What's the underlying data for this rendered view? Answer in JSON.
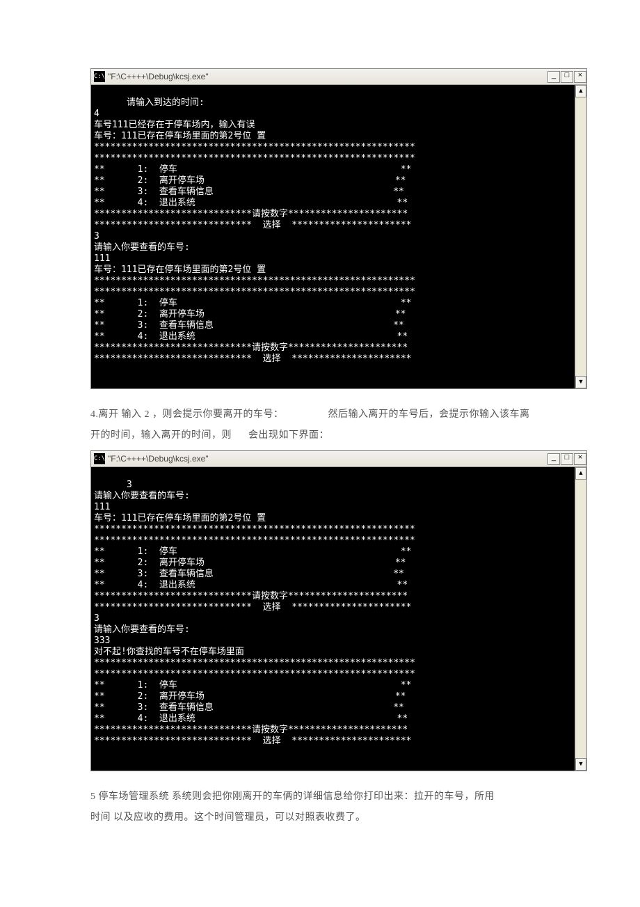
{
  "window_title": "\"F:\\C++++\\Debug\\kcsj.exe\"",
  "win_icon_text": "C:\\",
  "win_buttons": {
    "min": "_",
    "max": "□",
    "close": "×"
  },
  "scroll": {
    "up": "▲",
    "down": "▼"
  },
  "console1_lines": [
    "请输入到达的时间:",
    "4",
    "车号111已经存在于停车场内，输入有误",
    "车号：111已存在停车场里面的第2号位 置",
    "***********************************************************",
    "***********************************************************",
    "**      1:  停车                                         **",
    "**      2:  离开停车场                                   **",
    "**      3:  查看车辆信息                                 **",
    "**      4:  退出系统                                     **",
    "*****************************请按数字**********************",
    "*****************************  选择  **********************",
    "3",
    "请输入你要查看的车号:",
    "111",
    "车号：111已存在停车场里面的第2号位 置",
    "***********************************************************",
    "***********************************************************",
    "**      1:  停车                                         **",
    "**      2:  离开停车场                                   **",
    "**      3:  查看车辆信息                                 **",
    "**      4:  退出系统                                     **",
    "*****************************请按数字**********************",
    "*****************************  选择  **********************",
    ""
  ],
  "para4_a": "4.离开 输入 2 ，则会提示你要离开的车号：",
  "para4_b": "然后输入离开的车号后，会提示你输入该车离",
  "para4_c": "开的时间，输入离开的时间，则",
  "para4_d": "会出现如下界面：",
  "console2_lines": [
    "3",
    "请输入你要查看的车号:",
    "111",
    "车号：111已存在停车场里面的第2号位 置",
    "***********************************************************",
    "***********************************************************",
    "**      1:  停车                                         **",
    "**      2:  离开停车场                                   **",
    "**      3:  查看车辆信息                                 **",
    "**      4:  退出系统                                     **",
    "*****************************请按数字**********************",
    "*****************************  选择  **********************",
    "3",
    "请输入你要查看的车号:",
    "333",
    "对不起!你查找的车号不在停车场里面",
    "***********************************************************",
    "***********************************************************",
    "**      1:  停车                                         **",
    "**      2:  离开停车场                                   **",
    "**      3:  查看车辆信息                                 **",
    "**      4:  退出系统                                     **",
    "*****************************请按数字**********************",
    "*****************************  选择  **********************",
    ""
  ],
  "para5_a": "5 停车场管理系统  系统则会把你刚离开的车俩的详细信息给你打印出来：拉开的车号，所用",
  "para5_b": "时间 以及应收的费用。这个时间管理员，可以对照表收费了。"
}
